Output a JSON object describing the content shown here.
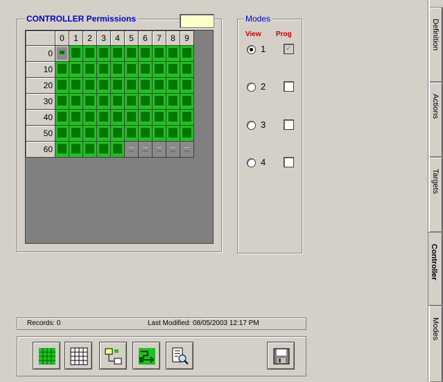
{
  "permissions": {
    "title": "CONTROLLER Permissions",
    "field_value": "",
    "columns": [
      "0",
      "1",
      "2",
      "3",
      "4",
      "5",
      "6",
      "7",
      "8",
      "9"
    ],
    "rows": [
      {
        "label": "0",
        "cells": [
          "sel",
          "on",
          "on",
          "on",
          "on",
          "on",
          "on",
          "on",
          "on",
          "on"
        ]
      },
      {
        "label": "10",
        "cells": [
          "on",
          "on",
          "on",
          "on",
          "on",
          "on",
          "on",
          "on",
          "on",
          "on"
        ]
      },
      {
        "label": "20",
        "cells": [
          "on",
          "on",
          "on",
          "on",
          "on",
          "on",
          "on",
          "on",
          "on",
          "on"
        ]
      },
      {
        "label": "30",
        "cells": [
          "on",
          "on",
          "on",
          "on",
          "on",
          "on",
          "on",
          "on",
          "on",
          "on"
        ]
      },
      {
        "label": "40",
        "cells": [
          "on",
          "on",
          "on",
          "on",
          "on",
          "on",
          "on",
          "on",
          "on",
          "on"
        ]
      },
      {
        "label": "50",
        "cells": [
          "on",
          "on",
          "on",
          "on",
          "on",
          "on",
          "on",
          "on",
          "on",
          "on"
        ]
      },
      {
        "label": "60",
        "cells": [
          "on",
          "on",
          "on",
          "on",
          "on",
          "off",
          "off",
          "off",
          "off",
          "off"
        ]
      }
    ]
  },
  "modes": {
    "title": "Modes",
    "view_label": "View",
    "prog_label": "Prog",
    "items": [
      {
        "label": "1",
        "selected": true,
        "prog": true
      },
      {
        "label": "2",
        "selected": false,
        "prog": false
      },
      {
        "label": "3",
        "selected": false,
        "prog": false
      },
      {
        "label": "4",
        "selected": false,
        "prog": false
      }
    ]
  },
  "status": {
    "records": "Records:  0",
    "last_modified": "Last Modified:   08/05/2003 12:17 PM"
  },
  "toolbar": {
    "buttons": [
      "select-all-icon",
      "grid-icon",
      "swap-icon",
      "transfer-icon",
      "preview-icon",
      "save-icon"
    ]
  },
  "tabs": [
    {
      "label": "Definition",
      "active": false
    },
    {
      "label": "Actions",
      "active": false
    },
    {
      "label": "Targets",
      "active": false
    },
    {
      "label": "Controller",
      "active": true
    },
    {
      "label": "Modes",
      "active": false
    }
  ],
  "colors": {
    "title": "#0000c8",
    "accent_red": "#c00000",
    "cell_on": "#22c022",
    "cell_inner": "#007800",
    "field": "#ffffcc"
  }
}
